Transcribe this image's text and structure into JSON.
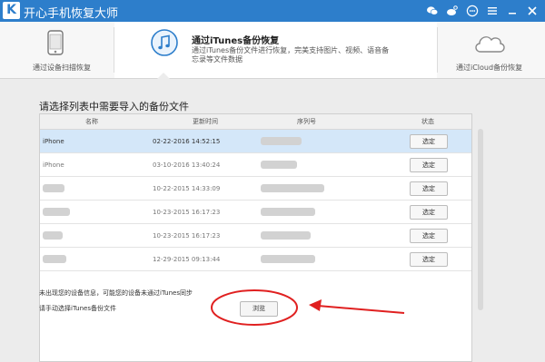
{
  "titlebar": {
    "app_title": "开心手机恢复大师",
    "logo_letter": "K",
    "bg_color": "#2d7ecb"
  },
  "modes": [
    {
      "label": "通过设备扫描恢复",
      "icon": "iphone-icon"
    },
    {
      "label": "通过iTunes备份恢复",
      "desc": "通过iTunes备份文件进行恢复，完美支持图片、视频、语音备忘录等文件数据",
      "icon": "music-note-icon",
      "active": true
    },
    {
      "label": "通过iCloud备份恢复",
      "icon": "cloud-icon"
    }
  ],
  "main": {
    "section_title": "请选择列表中需要导入的备份文件",
    "columns": [
      "名称",
      "更新时间",
      "序列号",
      "状态"
    ],
    "rows": [
      {
        "name": "iPhone",
        "time": "02-22-2016 14:52:15",
        "action": "选定",
        "selected": true
      },
      {
        "name": "iPhone",
        "time": "03-10-2016 13:40:24",
        "action": "选定"
      },
      {
        "name": "",
        "time": "10-22-2015 14:33:09",
        "action": "选定"
      },
      {
        "name": "",
        "time": "10-23-2015 16:17:23",
        "action": "选定"
      },
      {
        "name": "",
        "time": "10-23-2015 16:17:23",
        "action": "选定"
      },
      {
        "name": "",
        "time": "12-29-2015 09:13:44",
        "action": "选定"
      }
    ],
    "note_line1": "未出现您的设备信息，可能您的设备未通过iTunes同步",
    "note_line2": "请手动选择iTunes备份文件",
    "browse_label": "浏览"
  },
  "colors": {
    "accent": "#2d7ecb",
    "selected_row": "#d4e7f9",
    "annotation": "#e02020"
  }
}
